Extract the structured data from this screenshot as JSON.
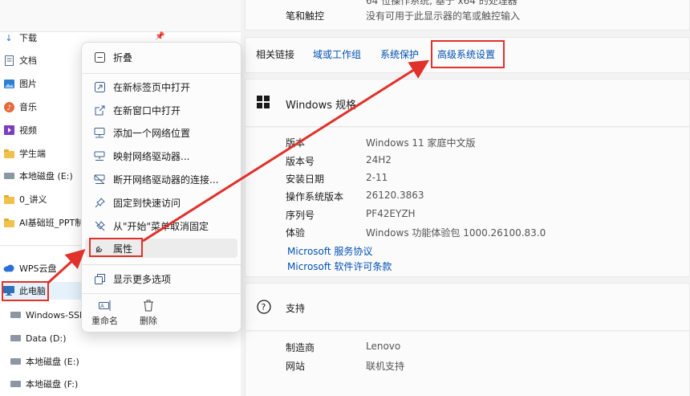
{
  "nav": {
    "items": [
      {
        "label": "下载",
        "icon": "download-icon"
      },
      {
        "label": "文档",
        "icon": "document-icon"
      },
      {
        "label": "图片",
        "icon": "picture-icon"
      },
      {
        "label": "音乐",
        "icon": "music-icon"
      },
      {
        "label": "视频",
        "icon": "video-icon"
      },
      {
        "label": "学生端",
        "icon": "folder-icon"
      },
      {
        "label": "本地磁盘 (E:)",
        "icon": "drive-icon"
      },
      {
        "label": "0_讲义",
        "icon": "folder-icon"
      },
      {
        "label": "AI基础班_PPT制",
        "icon": "folder-icon"
      }
    ],
    "cloud_label": "WPS云盘",
    "this_pc_label": "此电脑",
    "drives": [
      {
        "label": "Windows-SSD"
      },
      {
        "label": "Data (D:)"
      },
      {
        "label": "本地磁盘 (E:)"
      },
      {
        "label": "本地磁盘 (F:)"
      }
    ]
  },
  "context_menu": {
    "items": [
      {
        "label": "折叠",
        "icon": "collapse-icon"
      },
      {
        "label": "在新标签页中打开",
        "icon": "new-tab-icon"
      },
      {
        "label": "在新窗口中打开",
        "icon": "new-window-icon"
      },
      {
        "label": "添加一个网络位置",
        "icon": "network-location-icon"
      },
      {
        "label": "映射网络驱动器...",
        "icon": "map-drive-icon"
      },
      {
        "label": "断开网络驱动器的连接...",
        "icon": "disconnect-drive-icon"
      },
      {
        "label": "固定到快速访问",
        "icon": "pin-icon"
      },
      {
        "label": "从\"开始\"菜单取消固定",
        "icon": "unpin-icon"
      },
      {
        "label": "属性",
        "icon": "wrench-icon"
      },
      {
        "label": "显示更多选项",
        "icon": "more-options-icon"
      }
    ],
    "rename_label": "重命名",
    "delete_label": "删除"
  },
  "system": {
    "top_rows": [
      {
        "key": "",
        "value": "64 位操作系统, 基于 x64 的处理器"
      },
      {
        "key": "笔和触控",
        "value": "没有可用于此显示器的笔或触控输入"
      }
    ],
    "related": {
      "title": "相关链接",
      "links": [
        "域或工作组",
        "系统保护",
        "高级系统设置"
      ]
    },
    "windows_spec": {
      "title": "Windows 规格",
      "rows": [
        {
          "key": "版本",
          "value": "Windows 11 家庭中文版"
        },
        {
          "key": "版本号",
          "value": "24H2"
        },
        {
          "key": "安装日期",
          "value": "2-11"
        },
        {
          "key": "操作系统版本",
          "value": "26120.3863"
        },
        {
          "key": "序列号",
          "value": "PF42EYZH"
        },
        {
          "key": "体验",
          "value": "Windows 功能体验包 1000.26100.83.0"
        }
      ],
      "links": [
        "Microsoft 服务协议",
        "Microsoft 软件许可条款"
      ]
    },
    "support": {
      "title": "支持",
      "rows": [
        {
          "key": "制造商",
          "value": "Lenovo"
        },
        {
          "key": "网站",
          "value": "联机支持"
        }
      ]
    }
  },
  "colors": {
    "highlight_red": "#e0312a",
    "link_blue": "#0050b3"
  }
}
